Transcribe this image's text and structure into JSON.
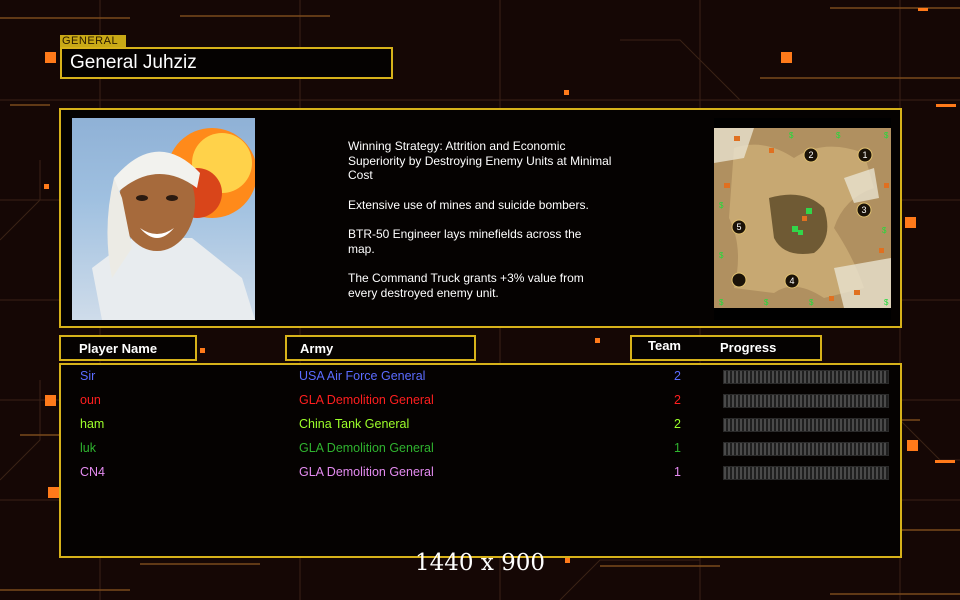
{
  "general": {
    "tag": "GENERAL",
    "name": "General Juhziz"
  },
  "strategy": [
    "Winning Strategy: Attrition and Economic\n Superiority by Destroying Enemy Units at Minimal\n Cost",
    "Extensive use of mines and suicide bombers.",
    "BTR-50 Engineer lays minefields across the\n map.",
    "The Command Truck grants +3% value from\n every destroyed enemy unit."
  ],
  "map": {
    "start_positions": [
      "1",
      "2",
      "3",
      "4",
      "5"
    ]
  },
  "headers": {
    "player_name": "Player Name",
    "army": "Army",
    "team": "Team",
    "progress": "Progress"
  },
  "players": [
    {
      "name": "Sir",
      "army": "USA Air Force General",
      "team": "2",
      "color": "#5b6cff",
      "progress": 0
    },
    {
      "name": "oun",
      "army": "GLA Demolition General",
      "team": "2",
      "color": "#ff1f1f",
      "progress": 0
    },
    {
      "name": "ham",
      "army": "China Tank General",
      "team": "2",
      "color": "#9cff2a",
      "progress": 0
    },
    {
      "name": "luk",
      "army": "GLA Demolition General",
      "team": "1",
      "color": "#2fb32f",
      "progress": 0
    },
    {
      "name": "CN4",
      "army": "GLA Demolition General",
      "team": "1",
      "color": "#e48bf0",
      "progress": 0
    }
  ],
  "resolution": "1440 x 900",
  "colors": {
    "accent": "#d7b21a",
    "background": "#150705"
  }
}
